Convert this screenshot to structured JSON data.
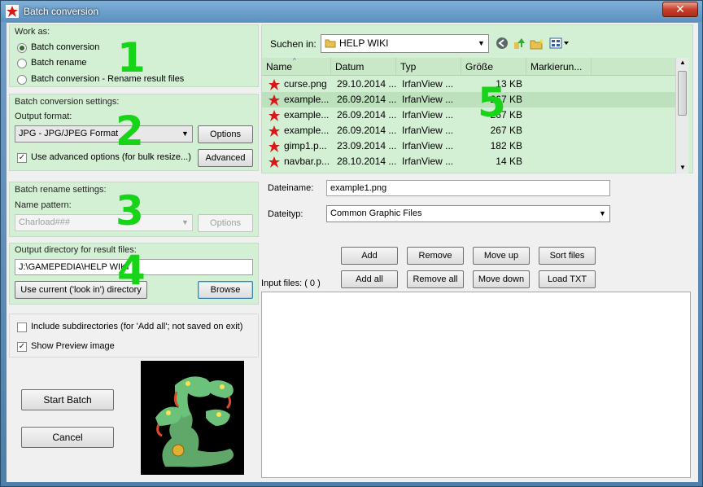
{
  "window": {
    "title": "Batch conversion",
    "close_glyph": "✕"
  },
  "work_as": {
    "label": "Work as:",
    "options": [
      {
        "label": "Batch conversion",
        "selected": true
      },
      {
        "label": "Batch rename",
        "selected": false
      },
      {
        "label": "Batch conversion - Rename result files",
        "selected": false
      }
    ]
  },
  "conversion_settings": {
    "label": "Batch conversion settings:",
    "output_format_label": "Output format:",
    "output_format_value": "JPG - JPG/JPEG Format",
    "options_button": "Options",
    "advanced_checkbox_label": "Use advanced options (for bulk resize...)",
    "advanced_checked": true,
    "advanced_button": "Advanced"
  },
  "rename_settings": {
    "label": "Batch rename settings:",
    "name_pattern_label": "Name pattern:",
    "name_pattern_value": "Charload###",
    "options_button": "Options"
  },
  "output_dir": {
    "label": "Output directory for result files:",
    "value": "J:\\GAMEPEDIA\\HELP WIKI",
    "use_current_button": "Use current ('look in') directory",
    "browse_button": "Browse"
  },
  "misc": {
    "include_subdirs_label": "Include subdirectories (for 'Add all'; not saved on exit)",
    "include_subdirs_checked": false,
    "show_preview_label": "Show Preview image",
    "show_preview_checked": true
  },
  "actions": {
    "start_button": "Start Batch",
    "cancel_button": "Cancel"
  },
  "annotations": [
    "1",
    "2",
    "3",
    "4",
    "5"
  ],
  "browser": {
    "look_in_label": "Suchen in:",
    "look_in_value": "HELP WIKI",
    "columns": [
      "Name",
      "Datum",
      "Typ",
      "Größe",
      "Markierun..."
    ],
    "files": [
      {
        "name": "curse.png",
        "date": "29.10.2014 ...",
        "type": "IrfanView ...",
        "size": "13 KB"
      },
      {
        "name": "example...",
        "date": "26.09.2014 ...",
        "type": "IrfanView ...",
        "size": "267 KB"
      },
      {
        "name": "example...",
        "date": "26.09.2014 ...",
        "type": "IrfanView ...",
        "size": "267 KB"
      },
      {
        "name": "example...",
        "date": "26.09.2014 ...",
        "type": "IrfanView ...",
        "size": "267 KB"
      },
      {
        "name": "gimp1.p...",
        "date": "23.09.2014 ...",
        "type": "IrfanView ...",
        "size": "182 KB"
      },
      {
        "name": "navbar.p...",
        "date": "28.10.2014 ...",
        "type": "IrfanView ...",
        "size": "14 KB"
      }
    ],
    "filename_label": "Dateiname:",
    "filename_value": "example1.png",
    "filetype_label": "Dateityp:",
    "filetype_value": "Common Graphic Files"
  },
  "list_buttons": {
    "add": "Add",
    "remove": "Remove",
    "move_up": "Move up",
    "sort": "Sort files",
    "add_all": "Add all",
    "remove_all": "Remove all",
    "move_down": "Move down",
    "load_txt": "Load TXT"
  },
  "input_files_label": "Input files: ( 0 )",
  "colors": {
    "panel_green": "#d4f0d4",
    "annotation_green": "#18d418"
  },
  "icons": [
    "app-icon",
    "back-icon",
    "up-folder-icon",
    "new-folder-icon",
    "view-menu-icon",
    "folder-icon",
    "file-icon",
    "dragon-preview-image"
  ]
}
